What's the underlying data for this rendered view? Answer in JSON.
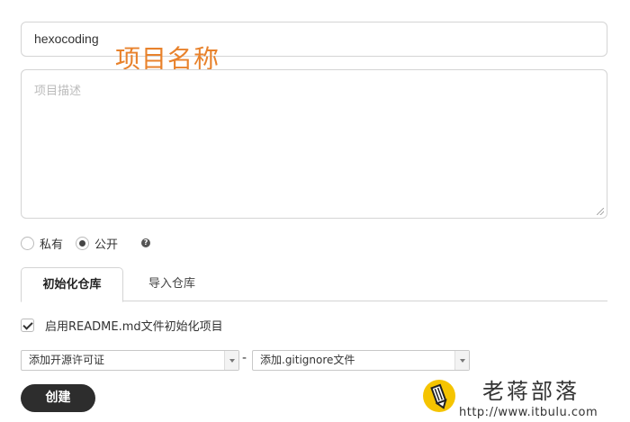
{
  "form": {
    "name_value": "hexocoding",
    "annotation": "项目名称",
    "description_placeholder": "项目描述"
  },
  "visibility": {
    "options": [
      {
        "label": "私有",
        "selected": false
      },
      {
        "label": "公开",
        "selected": true
      }
    ],
    "help_glyph": "?"
  },
  "tabs": [
    {
      "label": "初始化仓库",
      "active": true
    },
    {
      "label": "导入仓库",
      "active": false
    }
  ],
  "init": {
    "readme_label": "启用README.md文件初始化项目",
    "readme_checked": true,
    "license_select": "添加开源许可证",
    "separator": "-",
    "gitignore_select": "添加.gitignore文件"
  },
  "actions": {
    "create_label": "创建"
  },
  "watermark": {
    "title": "老蒋部落",
    "url": "http://www.itbulu.com"
  },
  "colors": {
    "annotation": "#e8822c",
    "button_bg": "#2d2d2d",
    "logo_yellow": "#f5c400"
  }
}
